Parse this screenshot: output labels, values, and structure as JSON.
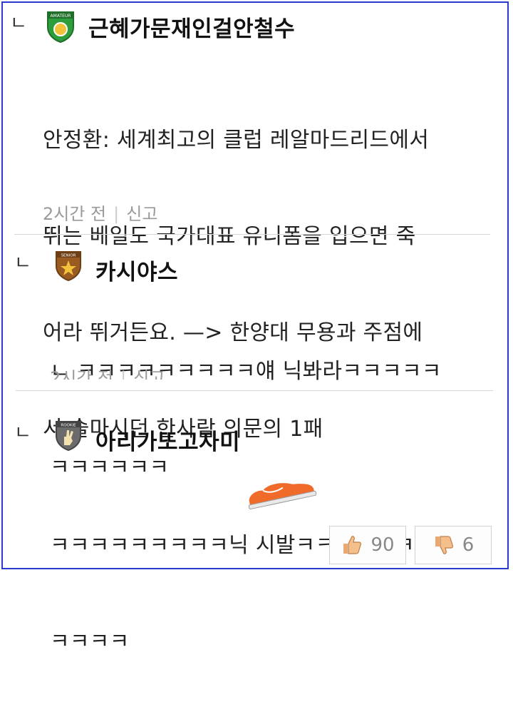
{
  "comments": [
    {
      "reply_mark": "ㄴ",
      "badge_icon": "amateur-badge-icon",
      "badge_text": "AMATEUR",
      "badge_color": "#2e9d3c",
      "username": "근혜가문재인걸안철수",
      "body_lines": [
        "안정환: 세계최고의 클럽 레알마드리드에서",
        "뛰는 베일도 국가대표 유니폼을 입으면 죽",
        "어라 뛰거든요. —> 한양대 무용과 주점에",
        "서 술마시던 한사람 의문의 1패"
      ],
      "time": "2시간 전",
      "report": "신고"
    },
    {
      "reply_mark": "ㄴ",
      "badge_icon": "senior-badge-icon",
      "badge_text": "SENIOR",
      "badge_color": "#9a5b22",
      "username": "카시야스",
      "body_lines": [
        "ㄴ ㅋㅋㅋㅋㅋㅋㅋㅋㅋ얘 닉봐라ㅋㅋㅋㅋㅋ",
        "ㅋㅋㅋㅋㅋㅋ"
      ],
      "time": "2시간 전",
      "report": "신고"
    },
    {
      "reply_mark": "ㄴ",
      "badge_icon": "rookie-badge-icon",
      "badge_text": "ROOKIE",
      "badge_color": "#6b6b6b",
      "username": "아리가또고자미",
      "body_lines": [
        "ㅋㅋㅋㅋㅋㅋㅋㅋㅋ닉 시발ㅋㅋㅋㅋㅋㅋㅋㅋㅋ",
        "ㅋㅋㅋㅋ"
      ]
    }
  ],
  "votes": {
    "like_icon": "thumbs-up-icon",
    "like_count": "90",
    "dislike_icon": "thumbs-down-icon",
    "dislike_count": "6"
  },
  "colors": {
    "frame": "#2b3bd0",
    "meta_text": "#9a9a9a",
    "sneaker": "#f06a2a"
  }
}
